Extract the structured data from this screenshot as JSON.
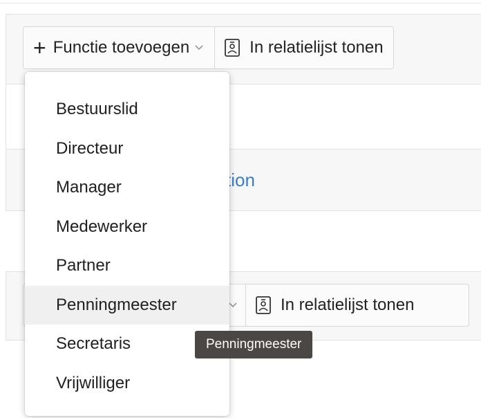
{
  "toolbar_top": {
    "add_function_label": "Functie toevoegen",
    "show_in_list_label": "In relatielijst tonen"
  },
  "toolbar_bottom": {
    "show_in_list_label": "In relatielijst tonen"
  },
  "background_link_fragment": "tion",
  "dropdown": {
    "options": [
      "Bestuurslid",
      "Directeur",
      "Manager",
      "Medewerker",
      "Partner",
      "Penningmeester",
      "Secretaris",
      "Vrijwilliger"
    ],
    "hovered": "Penningmeester"
  },
  "tooltip": "Penningmeester",
  "icons": {
    "add": "plus-icon",
    "dropdown": "chevron-down-icon",
    "list": "contact-card-icon"
  }
}
